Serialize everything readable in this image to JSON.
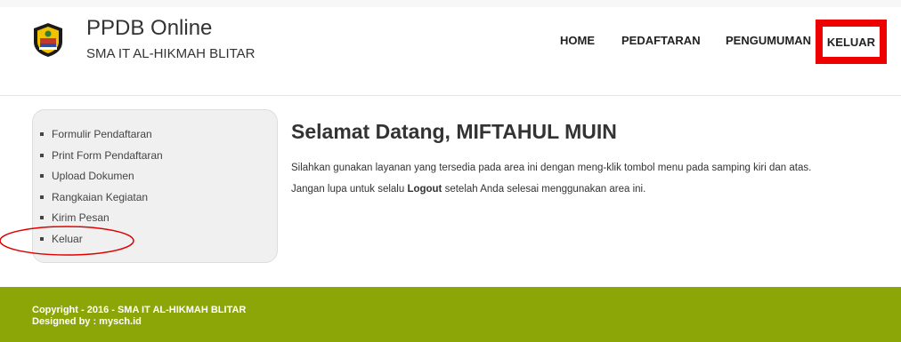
{
  "header": {
    "title": "PPDB Online",
    "subtitle": "SMA IT AL-HIKMAH BLITAR",
    "logo_icon": "school-emblem-icon"
  },
  "nav": {
    "items": [
      {
        "label": "HOME"
      },
      {
        "label": "PEDAFTARAN"
      },
      {
        "label": "PENGUMUMAN"
      },
      {
        "label": "KELUAR"
      }
    ],
    "highlight_color": "#ee0000"
  },
  "sidebar": {
    "items": [
      {
        "label": "Formulir Pendaftaran"
      },
      {
        "label": "Print Form Pendaftaran"
      },
      {
        "label": "Upload Dokumen"
      },
      {
        "label": "Rangkaian Kegiatan"
      },
      {
        "label": "Kirim Pesan"
      },
      {
        "label": "Keluar"
      }
    ]
  },
  "main": {
    "welcome_prefix": "Selamat Datang, ",
    "user_name": "MIFTAHUL MUIN",
    "line1": "Silahkan gunakan layanan yang tersedia pada area ini dengan meng-klik tombol menu pada samping kiri dan atas.",
    "line2_before": "Jangan lupa untuk selalu ",
    "line2_bold": "Logout",
    "line2_after": " setelah Anda selesai menggunakan area ini."
  },
  "footer": {
    "copyright": "Copyright - 2016 - SMA IT AL-HIKMAH BLITAR",
    "designed": "Designed by : mysch.id",
    "bg_color": "#8ca507"
  }
}
